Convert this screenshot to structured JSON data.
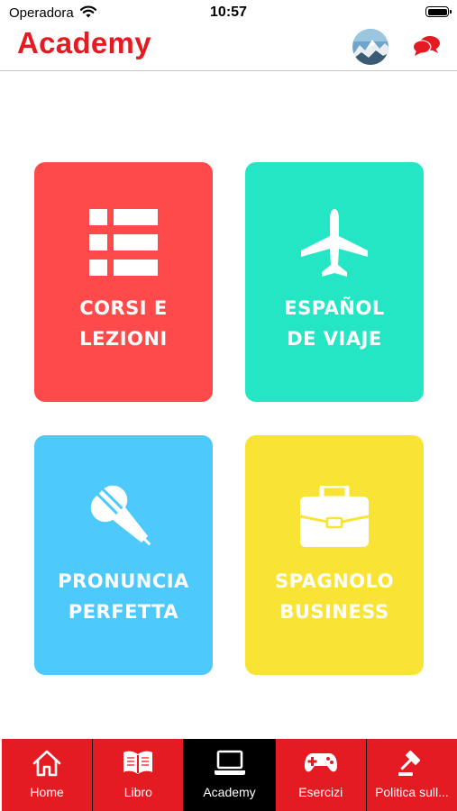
{
  "status_bar": {
    "carrier": "Operadora",
    "time": "10:57",
    "wifi_icon": "wifi-icon",
    "battery_icon": "battery-icon"
  },
  "header": {
    "title": "Academy",
    "avatar_icon": "avatar-photo",
    "chat_icon": "chat-bubbles-icon"
  },
  "tiles": [
    {
      "line1": "CORSI E",
      "line2": "LEZIONI",
      "icon": "list-icon",
      "color": "#fe4a4b"
    },
    {
      "line1": "ESPAÑOL",
      "line2": "DE VIAJE",
      "icon": "airplane-icon",
      "color": "#25e6c4"
    },
    {
      "line1": "PRONUNCIA",
      "line2": "PERFETTA",
      "icon": "microphone-icon",
      "color": "#4dc9fc"
    },
    {
      "line1": "SPAGNOLO",
      "line2": "BUSINESS",
      "icon": "briefcase-icon",
      "color": "#f9e435"
    }
  ],
  "tabbar": {
    "active_color": "#000000",
    "tab_color": "#e41b23",
    "items": [
      {
        "label": "Home",
        "icon": "home-icon",
        "active": false
      },
      {
        "label": "Libro",
        "icon": "book-icon",
        "active": false
      },
      {
        "label": "Academy",
        "icon": "laptop-icon",
        "active": true
      },
      {
        "label": "Esercizi",
        "icon": "gamepad-icon",
        "active": false
      },
      {
        "label": "Politica sull...",
        "icon": "gavel-icon",
        "active": false
      }
    ]
  }
}
